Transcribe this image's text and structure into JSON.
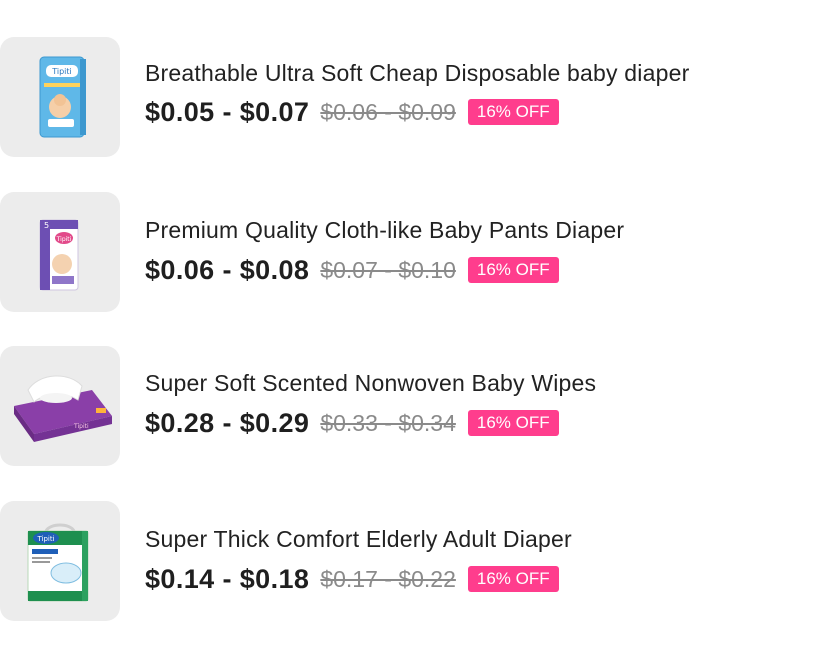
{
  "products": [
    {
      "title": "Breathable Ultra Soft Cheap Disposable baby diaper",
      "price": "$0.05 - $0.07",
      "original_price": "$0.06 - $0.09",
      "discount": "16% OFF",
      "brand": "Tipiti"
    },
    {
      "title": "Premium Quality Cloth-like Baby Pants Diaper",
      "price": "$0.06 - $0.08",
      "original_price": "$0.07 - $0.10",
      "discount": "16% OFF",
      "brand": "Tipiti"
    },
    {
      "title": "Super Soft Scented Nonwoven Baby Wipes",
      "price": "$0.28 - $0.29",
      "original_price": "$0.33 - $0.34",
      "discount": "16% OFF",
      "brand": "Tipiti"
    },
    {
      "title": "Super Thick Comfort Elderly Adult Diaper",
      "price": "$0.14 - $0.18",
      "original_price": "$0.17 - $0.22",
      "discount": "16% OFF",
      "brand": "Tipiti"
    }
  ],
  "colors": {
    "discount_badge": "#ff3d8d",
    "thumbnail_bg": "#ececec",
    "title_text": "#222222",
    "price_text": "#1f1f1f",
    "original_price_text": "#8a8a8a"
  }
}
